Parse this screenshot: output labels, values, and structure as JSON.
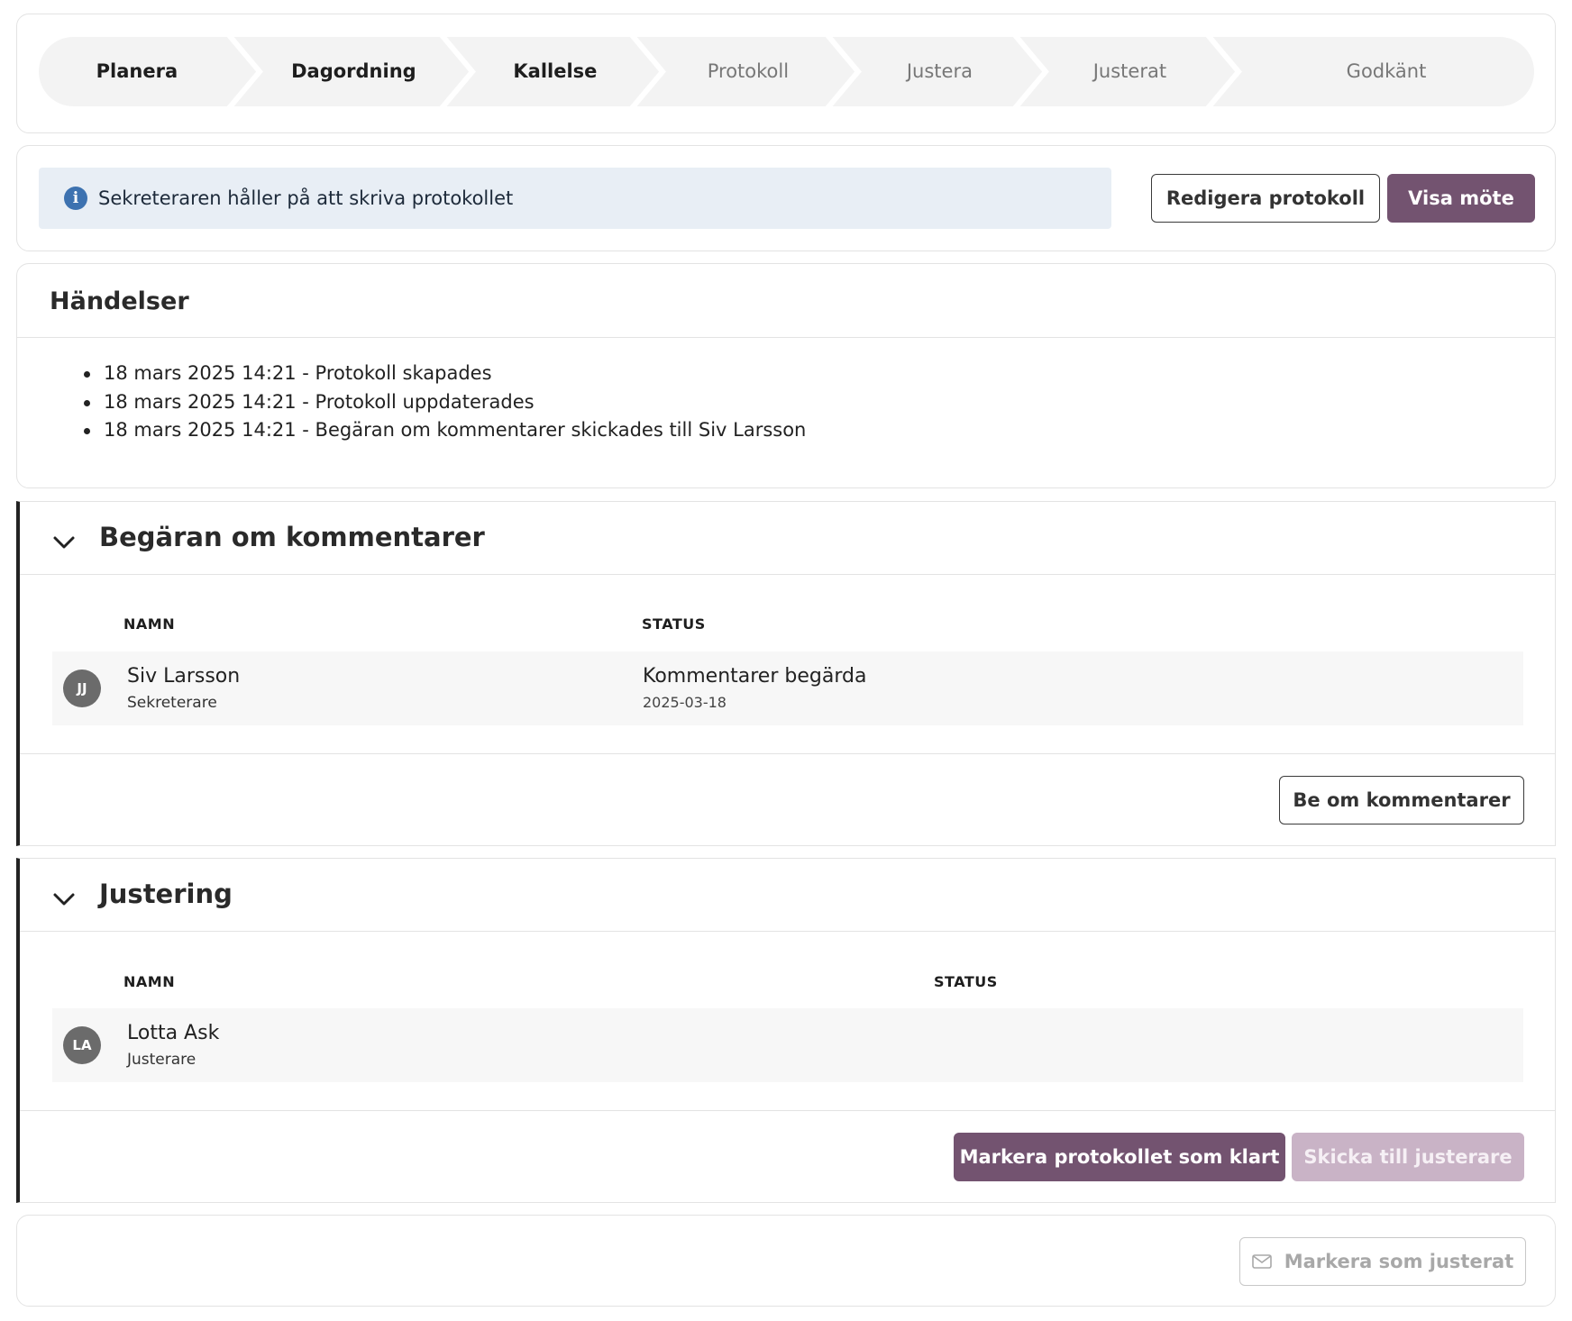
{
  "stepper": {
    "steps": [
      {
        "label": "Planera",
        "active": true
      },
      {
        "label": "Dagordning",
        "active": true
      },
      {
        "label": "Kallelse",
        "active": true
      },
      {
        "label": "Protokoll",
        "active": false
      },
      {
        "label": "Justera",
        "active": false
      },
      {
        "label": "Justerat",
        "active": false
      },
      {
        "label": "Godkänt",
        "active": false
      }
    ]
  },
  "info": {
    "icon": "info-icon",
    "message": "Sekreteraren håller på att skriva protokollet",
    "edit_button": "Redigera protokoll",
    "view_button": "Visa möte"
  },
  "events": {
    "title": "Händelser",
    "items": [
      "18 mars 2025 14:21 - Protokoll skapades",
      "18 mars 2025 14:21 - Protokoll uppdaterades",
      "18 mars 2025 14:21 - Begäran om kommentarer skickades till Siv Larsson"
    ]
  },
  "comments": {
    "title": "Begäran om kommentarer",
    "columns": {
      "name": "NAMN",
      "status": "STATUS"
    },
    "rows": [
      {
        "initials": "JJ",
        "name": "Siv Larsson",
        "role": "Sekreterare",
        "status": "Kommentarer begärda",
        "date": "2025-03-18"
      }
    ],
    "request_button": "Be om kommentarer"
  },
  "justering": {
    "title": "Justering",
    "columns": {
      "name": "NAMN",
      "status": "STATUS"
    },
    "rows": [
      {
        "initials": "LA",
        "name": "Lotta Ask",
        "role": "Justerare",
        "status": ""
      }
    ],
    "mark_ready_button": "Markera protokollet som klart",
    "send_button": "Skicka till justerare"
  },
  "footer": {
    "mark_adjusted_button": "Markera som justerat",
    "icon": "mail-icon"
  },
  "colors": {
    "primary": "#735370",
    "primary_disabled": "#c9b3c6",
    "info_bg": "#e8eef5",
    "info_icon": "#3d72b0"
  }
}
